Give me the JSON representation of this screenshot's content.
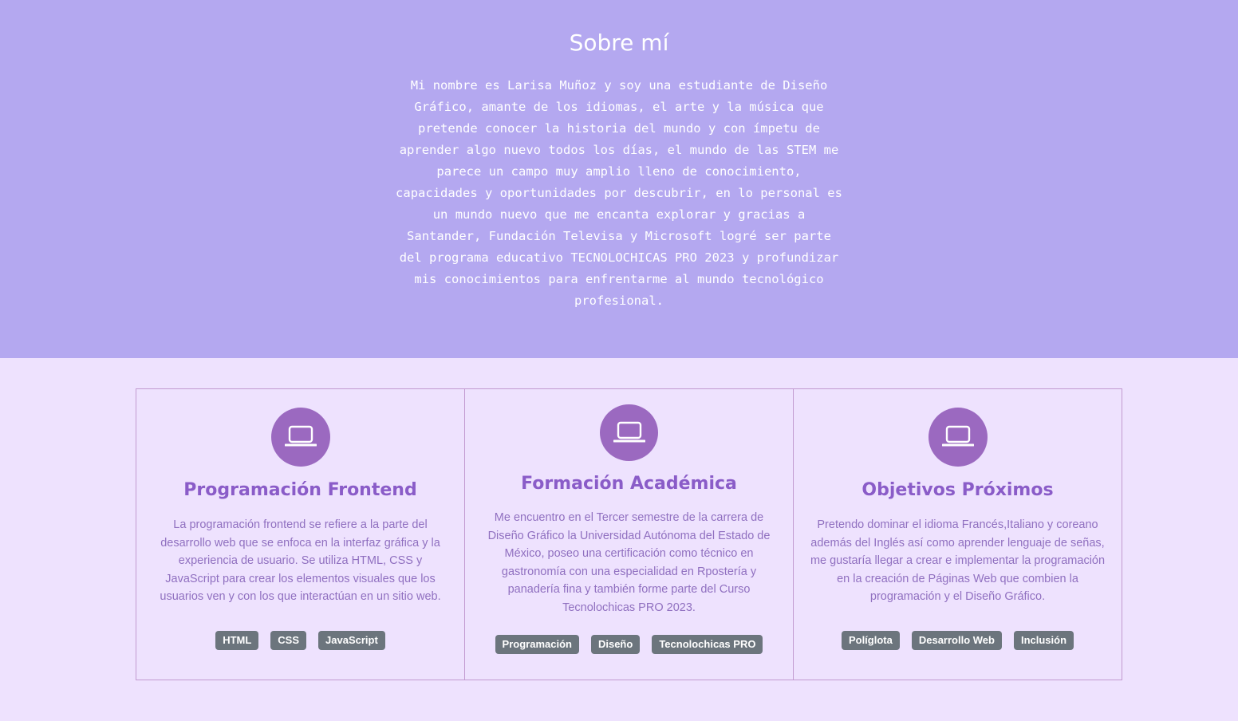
{
  "about": {
    "title": "Sobre mí",
    "text": "Mi nombre es Larisa Muñoz y soy una estudiante de Diseño Gráfico, amante de los idiomas, el arte y la música que pretende conocer la historia del mundo y con ímpetu de aprender algo nuevo todos los días, el mundo de las STEM me parece un campo muy amplio lleno de conocimiento, capacidades y oportunidades por descubrir, en lo personal es un mundo nuevo que me encanta explorar y gracias a Santander, Fundación Televisa y Microsoft logré ser parte del programa educativo TECNOLOCHICAS PRO 2023 y profundizar mis conocimientos para enfrentarme al mundo tecnológico profesional."
  },
  "cards": [
    {
      "icon": "laptop-icon",
      "title": "Programación Frontend",
      "text": "La programación frontend se refiere a la parte del desarrollo web que se enfoca en la interfaz gráfica y la experiencia de usuario. Se utiliza HTML, CSS y JavaScript para crear los elementos visuales que los usuarios ven y con los que interactúan en un sitio web.",
      "tags": [
        "HTML",
        "CSS",
        "JavaScript"
      ]
    },
    {
      "icon": "laptop-icon",
      "title": "Formación Académica",
      "text": "Me encuentro en el Tercer semestre de la carrera de Diseño Gráfico la Universidad Autónoma del Estado de México, poseo una certificación como técnico en gastronomía con una especialidad en Rpostería y panadería fina y también forme parte del Curso Tecnolochicas PRO 2023.",
      "tags": [
        "Programación",
        "Diseño",
        "Tecnolochicas PRO"
      ]
    },
    {
      "icon": "laptop-icon",
      "title": "Objetivos Próximos",
      "text": "Pretendo dominar el idioma Francés,Italiano y coreano además del Inglés así como aprender lenguaje de señas, me gustaría llegar a crear e implementar la programación en la creación de Páginas Web que combien la programación y el Diseño Gráfico.",
      "tags": [
        "Políglota",
        "Desarrollo Web",
        "Inclusión"
      ]
    }
  ],
  "colors": {
    "header_bg": "#b4a8f0",
    "page_bg": "#eee2fe",
    "icon_circle": "#9b69c0",
    "card_title": "#8a5cc8",
    "tag_bg": "#6c757d"
  }
}
